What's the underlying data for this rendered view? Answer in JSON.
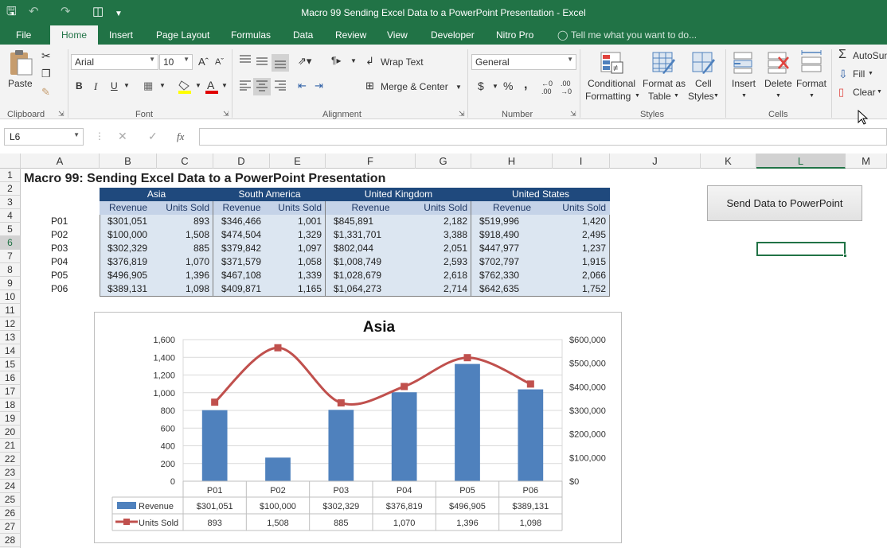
{
  "window": {
    "title": "Macro 99 Sending Excel Data to a PowerPoint Presentation - Excel"
  },
  "tabs": [
    "File",
    "Home",
    "Insert",
    "Page Layout",
    "Formulas",
    "Data",
    "Review",
    "View",
    "Developer",
    "Nitro Pro"
  ],
  "active_tab": "Home",
  "tell_me": "Tell me what you want to do...",
  "ribbon": {
    "clipboard": {
      "paste": "Paste",
      "label": "Clipboard"
    },
    "font": {
      "name": "Arial",
      "size": "10",
      "label": "Font",
      "bold": "B",
      "italic": "I",
      "underline": "U"
    },
    "alignment": {
      "wrap": "Wrap Text",
      "merge": "Merge & Center",
      "label": "Alignment"
    },
    "number": {
      "format": "General",
      "label": "Number",
      "currency": "$",
      "percent": "%",
      "comma": ","
    },
    "styles": {
      "conditional1": "Conditional",
      "conditional2": "Formatting",
      "format_as1": "Format as",
      "format_as2": "Table",
      "cell1": "Cell",
      "cell2": "Styles",
      "label": "Styles"
    },
    "cells": {
      "insert": "Insert",
      "delete": "Delete",
      "format": "Format",
      "label": "Cells"
    },
    "editing": {
      "autosum": "AutoSum",
      "fill": "Fill",
      "clear": "Clear"
    }
  },
  "name_box": "L6",
  "fx": "fx",
  "columns": [
    "A",
    "B",
    "C",
    "D",
    "E",
    "F",
    "G",
    "H",
    "I",
    "J",
    "K",
    "L",
    "M"
  ],
  "selected_column": "L",
  "rows": [
    "1",
    "2",
    "3",
    "4",
    "5",
    "6",
    "7",
    "8",
    "9",
    "10",
    "11",
    "12",
    "13",
    "14",
    "15",
    "16",
    "17",
    "18",
    "19",
    "20",
    "21",
    "22",
    "23",
    "24",
    "25",
    "26",
    "27",
    "28"
  ],
  "selected_row": "6",
  "sheet": {
    "title": "Macro 99: Sending Excel Data to a PowerPoint Presentation",
    "regions": [
      "Asia",
      "South America",
      "United Kingdom",
      "United States"
    ],
    "subheaders": [
      "Revenue",
      "Units Sold"
    ],
    "products": [
      "P01",
      "P02",
      "P03",
      "P04",
      "P05",
      "P06"
    ],
    "data": [
      [
        [
          "$301,051",
          "893"
        ],
        [
          "$346,466",
          "1,001"
        ],
        [
          "$845,891",
          "2,182"
        ],
        [
          "$519,996",
          "1,420"
        ]
      ],
      [
        [
          "$100,000",
          "1,508"
        ],
        [
          "$474,504",
          "1,329"
        ],
        [
          "$1,331,701",
          "3,388"
        ],
        [
          "$918,490",
          "2,495"
        ]
      ],
      [
        [
          "$302,329",
          "885"
        ],
        [
          "$379,842",
          "1,097"
        ],
        [
          "$802,044",
          "2,051"
        ],
        [
          "$447,977",
          "1,237"
        ]
      ],
      [
        [
          "$376,819",
          "1,070"
        ],
        [
          "$371,579",
          "1,058"
        ],
        [
          "$1,008,749",
          "2,593"
        ],
        [
          "$702,797",
          "1,915"
        ]
      ],
      [
        [
          "$496,905",
          "1,396"
        ],
        [
          "$467,108",
          "1,339"
        ],
        [
          "$1,028,679",
          "2,618"
        ],
        [
          "$762,330",
          "2,066"
        ]
      ],
      [
        [
          "$389,131",
          "1,098"
        ],
        [
          "$409,871",
          "1,165"
        ],
        [
          "$1,064,273",
          "2,714"
        ],
        [
          "$642,635",
          "1,752"
        ]
      ]
    ]
  },
  "button": {
    "label": "Send Data to PowerPoint"
  },
  "chart_data": {
    "type": "bar",
    "title": "Asia",
    "categories": [
      "P01",
      "P02",
      "P03",
      "P04",
      "P05",
      "P06"
    ],
    "series": [
      {
        "name": "Revenue",
        "type": "bar",
        "axis": "secondary",
        "values": [
          301051,
          100000,
          302329,
          376819,
          496905,
          389131
        ],
        "labels": [
          "$301,051",
          "$100,000",
          "$302,329",
          "$376,819",
          "$496,905",
          "$389,131"
        ]
      },
      {
        "name": "Units Sold",
        "type": "line",
        "axis": "primary",
        "values": [
          893,
          1508,
          885,
          1070,
          1396,
          1098
        ],
        "labels": [
          "893",
          "1,508",
          "885",
          "1,070",
          "1,396",
          "1,098"
        ]
      }
    ],
    "left_axis": {
      "ylim": [
        0,
        1600
      ],
      "ticks": [
        "0",
        "200",
        "400",
        "600",
        "800",
        "1,000",
        "1,200",
        "1,400",
        "1,600"
      ]
    },
    "right_axis": {
      "ylim": [
        0,
        600000
      ],
      "ticks": [
        "$0",
        "$100,000",
        "$200,000",
        "$300,000",
        "$400,000",
        "$500,000",
        "$600,000"
      ]
    },
    "grid": true,
    "data_table": true,
    "colors": {
      "bar": "#4f81bd",
      "line": "#c0504d"
    }
  }
}
